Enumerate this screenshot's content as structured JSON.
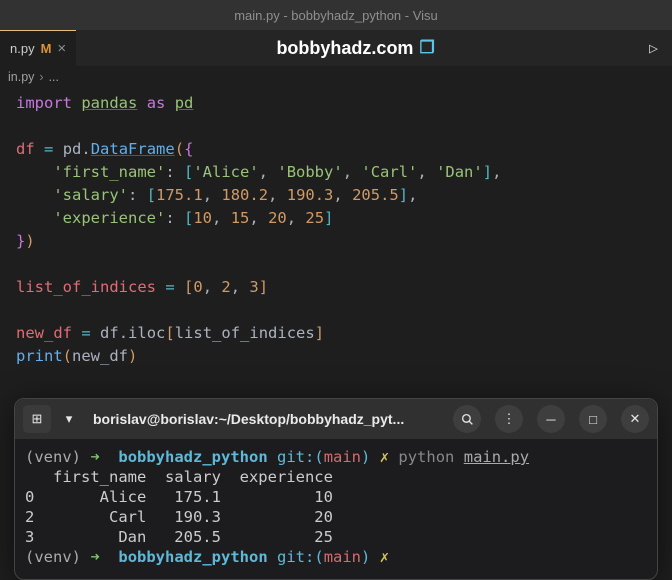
{
  "window": {
    "title": "main.py - bobbyhadz_python - Visu"
  },
  "tab": {
    "name": "n.py",
    "mark": "M"
  },
  "banner": {
    "text": "bobbyhadz.com"
  },
  "breadcrumb": {
    "file": "in.py",
    "rest": "..."
  },
  "code": {
    "l1": {
      "import": "import",
      "module": "pandas",
      "as": "as",
      "alias": "pd"
    },
    "l3": {
      "var": "df",
      "eq": "=",
      "pd": "pd",
      "cls": "DataFrame"
    },
    "l4": {
      "key": "'first_name'",
      "vals": [
        "'Alice'",
        "'Bobby'",
        "'Carl'",
        "'Dan'"
      ]
    },
    "l5": {
      "key": "'salary'",
      "vals": [
        "175.1",
        "180.2",
        "190.3",
        "205.5"
      ]
    },
    "l6": {
      "key": "'experience'",
      "vals": [
        "10",
        "15",
        "20",
        "25"
      ]
    },
    "l9": {
      "var": "list_of_indices",
      "eq": "=",
      "vals": [
        "0",
        "2",
        "3"
      ]
    },
    "l11": {
      "var": "new_df",
      "eq": "=",
      "src": "df",
      "attr": "iloc",
      "arg": "list_of_indices"
    },
    "l12": {
      "fn": "print",
      "arg": "new_df"
    }
  },
  "terminal": {
    "title": "borislav@borislav:~/Desktop/bobbyhadz_pyt...",
    "prompt": {
      "venv": "(venv)",
      "arrow": "➜",
      "path": "bobbyhadz_python",
      "git_label": "git:(",
      "branch": "main",
      "git_close": ")",
      "x": "✗"
    },
    "cmd": {
      "python": "python",
      "file": "main.py"
    },
    "output_header": "   first_name  salary  experience",
    "rows": [
      "0       Alice   175.1          10",
      "2        Carl   190.3          20",
      "3         Dan   205.5          25"
    ]
  }
}
